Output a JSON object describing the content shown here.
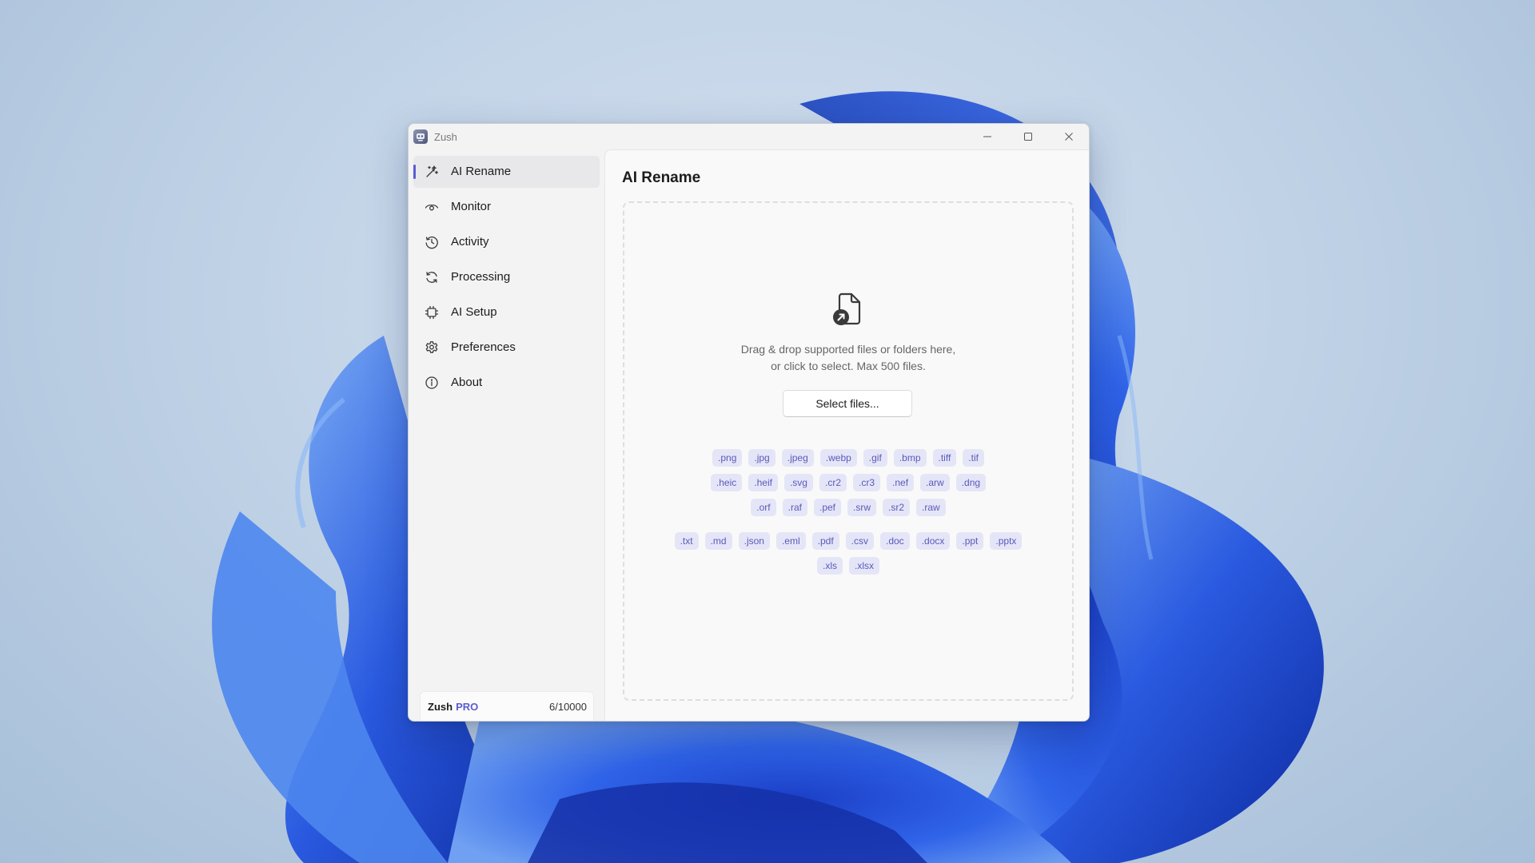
{
  "window": {
    "title": "Zush",
    "controls": {
      "minimize_icon": "minimize-icon",
      "maximize_icon": "maximize-icon",
      "close_icon": "close-icon"
    }
  },
  "sidebar": {
    "items": [
      {
        "label": "AI Rename",
        "icon": "magic-wand-icon",
        "active": true
      },
      {
        "label": "Monitor",
        "icon": "eye-icon",
        "active": false
      },
      {
        "label": "Activity",
        "icon": "history-icon",
        "active": false
      },
      {
        "label": "Processing",
        "icon": "refresh-icon",
        "active": false
      },
      {
        "label": "AI Setup",
        "icon": "chip-icon",
        "active": false
      },
      {
        "label": "Preferences",
        "icon": "gear-icon",
        "active": false
      },
      {
        "label": "About",
        "icon": "info-icon",
        "active": false
      }
    ],
    "plan": {
      "name": "Zush",
      "badge": "PRO",
      "usage_text": "6/10000",
      "usage_fraction": 0.0006
    }
  },
  "main": {
    "title": "AI Rename",
    "dropzone": {
      "icon": "file-import-icon",
      "hint_line1": "Drag & drop supported files or folders here,",
      "hint_line2": "or click to select. Max 500 files.",
      "select_button": "Select files..."
    },
    "image_formats": [
      [
        ".png",
        ".jpg",
        ".jpeg",
        ".webp",
        ".gif",
        ".bmp",
        ".tiff",
        ".tif"
      ],
      [
        ".heic",
        ".heif",
        ".svg",
        ".cr2",
        ".cr3",
        ".nef",
        ".arw",
        ".dng"
      ],
      [
        ".orf",
        ".raf",
        ".pef",
        ".srw",
        ".sr2",
        ".raw"
      ]
    ],
    "document_formats": [
      [
        ".txt",
        ".md",
        ".json",
        ".eml",
        ".pdf",
        ".csv",
        ".doc",
        ".docx",
        ".ppt",
        ".pptx"
      ],
      [
        ".xls",
        ".xlsx"
      ]
    ]
  },
  "colors": {
    "accent": "#5b5bd6",
    "chip_background": "#e5e5f8",
    "chip_text": "#5a5ab9",
    "window_background": "#f3f3f3",
    "content_background": "#f9f9f9"
  }
}
